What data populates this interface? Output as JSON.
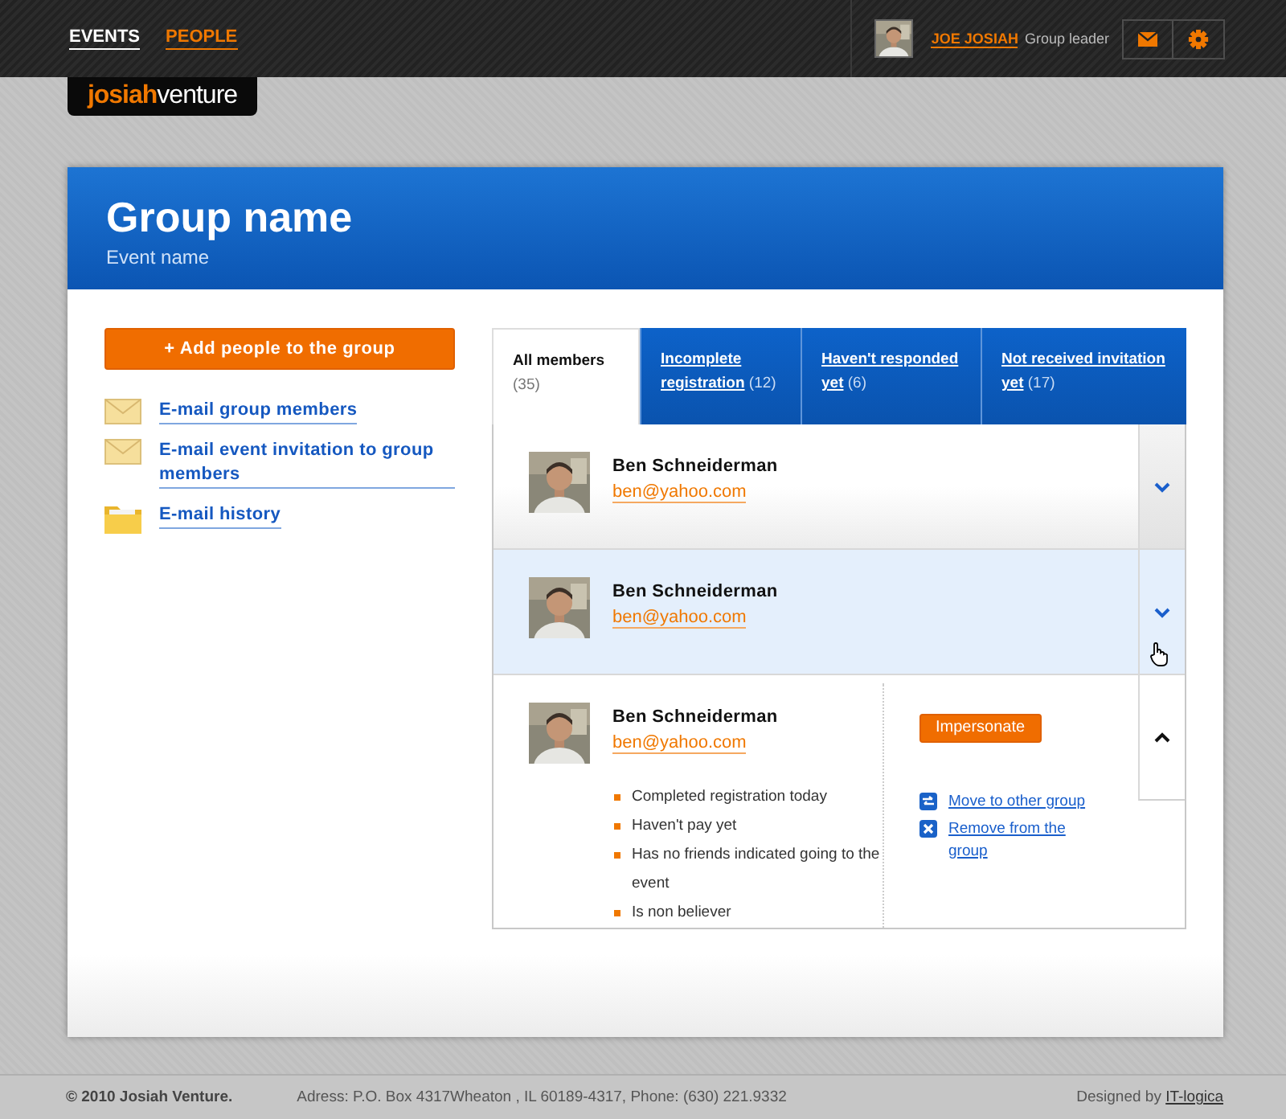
{
  "topbar": {
    "nav": [
      {
        "label": "EVENTS",
        "selected": true
      },
      {
        "label": "PEOPLE",
        "selected": false
      }
    ],
    "logo": {
      "bold": "josiah",
      "light": "venture"
    },
    "user": {
      "name": "JOE JOSIAH",
      "role": "Group leader"
    }
  },
  "header": {
    "title": "Group name",
    "subtitle": "Event name"
  },
  "sidebar": {
    "add_button": "+ Add people to the group",
    "links": [
      {
        "kind": "mail",
        "label": "E-mail group members"
      },
      {
        "kind": "mail",
        "label": "E-mail event invitation to group members"
      },
      {
        "kind": "folder",
        "label": "E-mail history"
      }
    ]
  },
  "tabs": [
    {
      "label": "All members",
      "count": "(35)",
      "selected": true
    },
    {
      "label": "Incomplete registration",
      "count": "(12)",
      "selected": false
    },
    {
      "label": "Haven't responded yet",
      "count": "(6)",
      "selected": false
    },
    {
      "label": "Not received invitation yet",
      "count": "(17)",
      "selected": false
    }
  ],
  "members": [
    {
      "name": "Ben Schneiderman",
      "email": "ben@yahoo.com",
      "highlighted": false,
      "expanded": false
    },
    {
      "name": "Ben Schneiderman",
      "email": "ben@yahoo.com",
      "highlighted": true,
      "expanded": false
    },
    {
      "name": "Ben Schneiderman",
      "email": "ben@yahoo.com",
      "highlighted": false,
      "expanded": true,
      "notes": [
        "Completed registration today",
        "Haven't pay yet",
        "Has no friends indicated going to the event",
        "Is non believer"
      ],
      "button": "Impersonate",
      "actions": [
        {
          "kind": "move",
          "label": "Move to other group"
        },
        {
          "kind": "remove",
          "label": "Remove from the group"
        }
      ]
    }
  ],
  "footer": {
    "copyright": "© 2010 Josiah Venture.",
    "address": "Adress: P.O. Box 4317Wheaton , IL 60189-4317, Phone: (630) 221.9332",
    "credit": "Designed by",
    "credit_link": "IT-logica"
  }
}
